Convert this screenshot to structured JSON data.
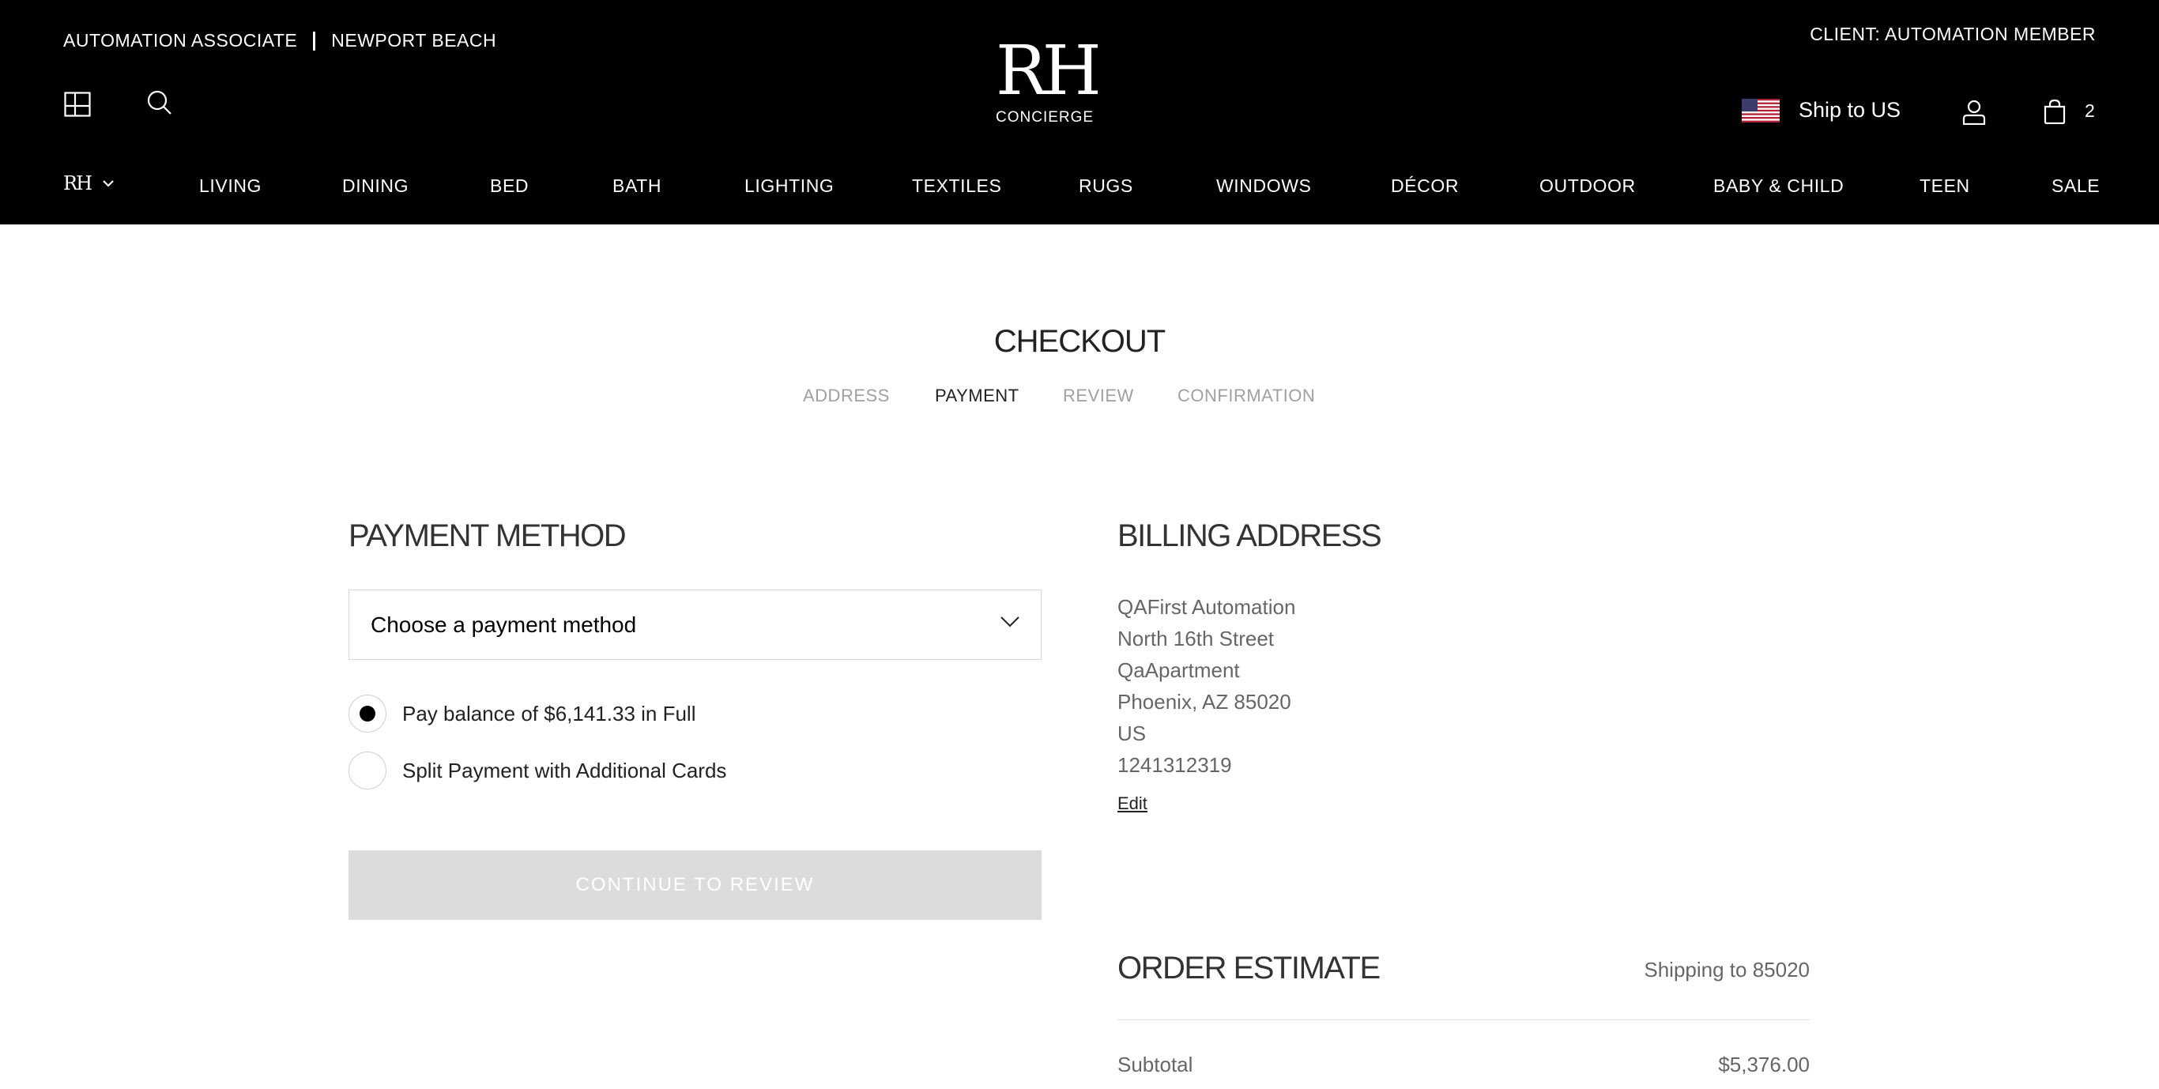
{
  "header": {
    "associate": "AUTOMATION ASSOCIATE",
    "location": "NEWPORT BEACH",
    "client": "CLIENT: AUTOMATION MEMBER",
    "logo_mark": "RH",
    "logo_sub": "CONCIERGE",
    "ship_to": "Ship to US",
    "cart_count": "2",
    "brand_switch": "RH",
    "icons": {
      "grid": "grid-icon",
      "search": "search-icon",
      "flag": "us-flag-icon",
      "account": "account-icon",
      "cart": "cart-icon"
    }
  },
  "nav": {
    "items": [
      "LIVING",
      "DINING",
      "BED",
      "BATH",
      "LIGHTING",
      "TEXTILES",
      "RUGS",
      "WINDOWS",
      "DÉCOR",
      "OUTDOOR",
      "BABY & CHILD",
      "TEEN",
      "SALE"
    ]
  },
  "checkout": {
    "title": "CHECKOUT",
    "steps": [
      "ADDRESS",
      "PAYMENT",
      "REVIEW",
      "CONFIRMATION"
    ],
    "active_step": "PAYMENT"
  },
  "payment": {
    "title": "PAYMENT METHOD",
    "select_value": "Choose a payment method",
    "option_full": "Pay balance of $6,141.33 in Full",
    "option_split": "Split Payment with Additional Cards",
    "selected_option": "full",
    "continue_label": "CONTINUE TO REVIEW"
  },
  "billing": {
    "title": "BILLING ADDRESS",
    "lines": [
      "QAFirst Automation",
      "North 16th Street",
      "QaApartment",
      "Phoenix, AZ 85020",
      "US",
      "1241312319"
    ],
    "edit_label": "Edit"
  },
  "order": {
    "title": "ORDER ESTIMATE",
    "shipping_to": "Shipping to 85020",
    "subtotal_label": "Subtotal",
    "subtotal_value": "$5,376.00"
  },
  "colors": {
    "header_bg": "#000000",
    "disabled_button": "#dcdcdc",
    "muted_text": "#666666"
  }
}
